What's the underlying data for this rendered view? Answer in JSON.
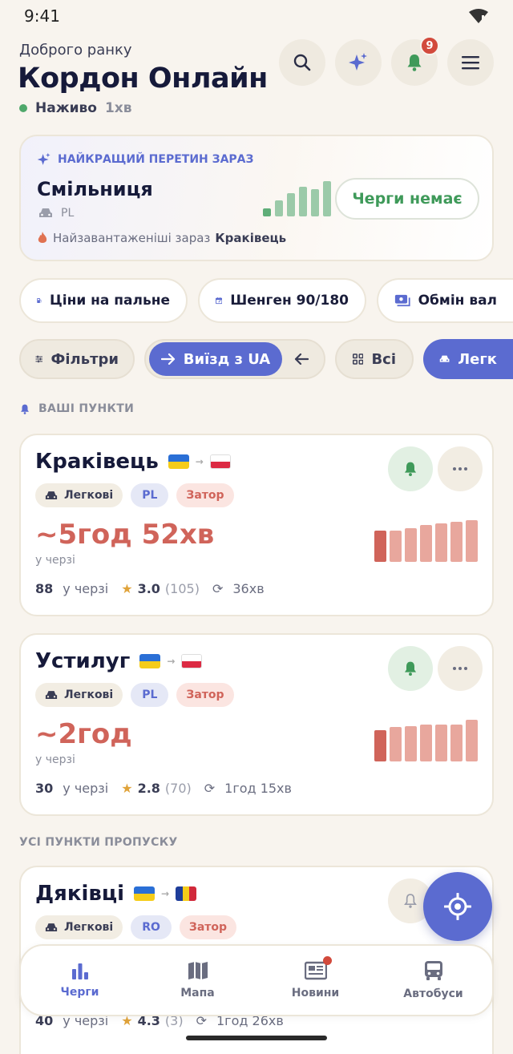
{
  "status_bar": {
    "time": "9:41"
  },
  "header": {
    "greeting": "Доброго ранку",
    "title": "Кордон Онлайн",
    "live_label": "Наживо",
    "live_time": "1хв",
    "notif_count": "9"
  },
  "best": {
    "label": "НАЙКРАЩИЙ ПЕРЕТИН ЗАРАЗ",
    "name": "Смільниця",
    "country": "PL",
    "status": "Черги немає",
    "busy_label": "Найзавантаженіші зараз",
    "busy_name": "Краківець",
    "bars": [
      0.22,
      0.45,
      0.65,
      0.85,
      0.78,
      1.0
    ]
  },
  "quick_links": [
    "Ціни на пальне",
    "Шенген 90/180",
    "Обмін вал"
  ],
  "filters": {
    "filters_label": "Фільтри",
    "direction_label": "Виїзд з UA",
    "all_label": "Всі",
    "vehicle_label": "Легк"
  },
  "sections": {
    "mine": "ВАШІ ПУНКТИ",
    "all": "УСІ ПУНКТИ ПРОПУСКУ"
  },
  "cards": [
    {
      "name": "Краківець",
      "vehicle": "Легкові",
      "country": "PL",
      "status": "Затор",
      "wait": "~5год 52хв",
      "in_queue_label": "у черзі",
      "queue_count": "88",
      "queue_label": "у черзі",
      "rating": "3.0",
      "reviews": "(105)",
      "updated": "36хв",
      "bars": [
        0.75,
        0.75,
        0.8,
        0.88,
        0.92,
        0.96,
        1.0
      ]
    },
    {
      "name": "Устилуг",
      "vehicle": "Легкові",
      "country": "PL",
      "status": "Затор",
      "wait": "~2год",
      "in_queue_label": "у черзі",
      "queue_count": "30",
      "queue_label": "у черзі",
      "rating": "2.8",
      "reviews": "(70)",
      "updated": "1год 15хв",
      "bars": [
        0.75,
        0.82,
        0.85,
        0.88,
        0.88,
        0.88,
        1.0
      ]
    },
    {
      "name": "Дяківці",
      "vehicle": "Легкові",
      "country": "RO",
      "status": "Затор",
      "queue_count": "40",
      "queue_label": "у черзі",
      "rating": "4.3",
      "reviews": "(3)",
      "updated": "1год 26хв"
    }
  ],
  "tabs": [
    "Черги",
    "Мапа",
    "Новини",
    "Автобуси"
  ],
  "colors": {
    "accent": "#5b6bd0",
    "danger": "#d0645a",
    "success": "#3f9a5a",
    "background": "#f8f4ee"
  }
}
